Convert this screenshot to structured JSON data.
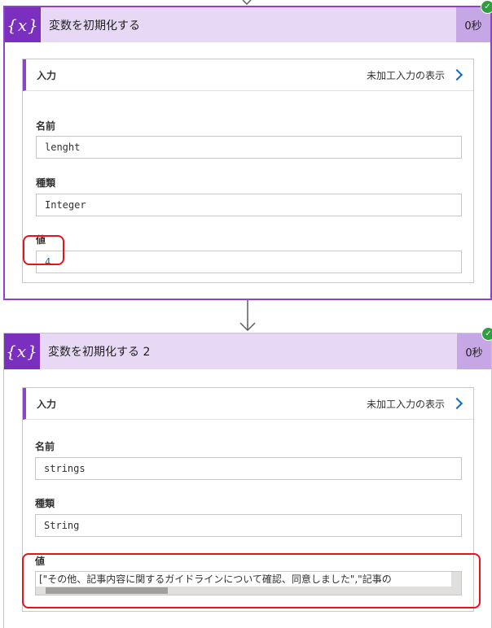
{
  "cards": [
    {
      "title": "変数を初期化する",
      "duration": "0秒",
      "inputs_label": "入力",
      "raw_link": "未加工入力の表示",
      "name_label": "名前",
      "name_value": "lenght",
      "type_label": "種類",
      "type_value": "Integer",
      "value_label": "値",
      "value_value": "4"
    },
    {
      "title": "変数を初期化する 2",
      "duration": "0秒",
      "inputs_label": "入力",
      "raw_link": "未加工入力の表示",
      "name_label": "名前",
      "name_value": "strings",
      "type_label": "種類",
      "type_value": "String",
      "value_label": "値",
      "value_value": "[\"その他、記事内容に関するガイドラインについて確認、同意しました\",\"記事の"
    }
  ],
  "icons": {
    "header": "variable-curly-x-icon",
    "status": "success-check-icon",
    "connector": "down-arrow-icon",
    "raw": "chevron-right-icon"
  },
  "colors": {
    "accent": "#8a46c6",
    "header_bg": "#e7d9f5",
    "icon_bg": "#7b2fbf",
    "success": "#2e9e3e",
    "highlight": "#e8121b"
  }
}
